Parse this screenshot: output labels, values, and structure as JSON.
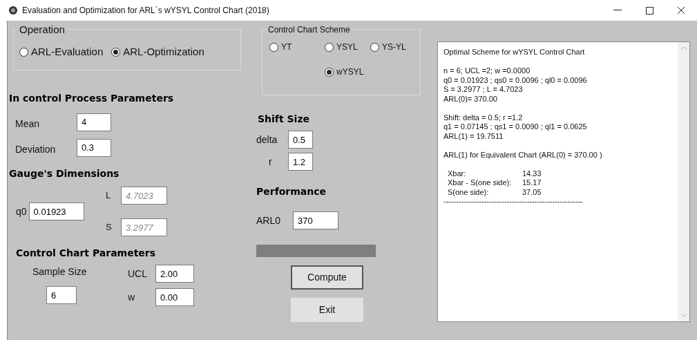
{
  "window": {
    "title": "Evaluation and Optimization for ARL´s wYSYL Control Chart (2018)"
  },
  "operation": {
    "title": "Operation",
    "options": [
      {
        "label": "ARL-Evaluation",
        "selected": false
      },
      {
        "label": "ARL-Optimization",
        "selected": true
      }
    ]
  },
  "scheme": {
    "title": "Control Chart Scheme",
    "options": [
      {
        "label": "YT",
        "selected": false
      },
      {
        "label": "YSYL",
        "selected": false
      },
      {
        "label": "YS-YL",
        "selected": false
      },
      {
        "label": "wYSYL",
        "selected": true
      }
    ]
  },
  "process": {
    "title": "In control Process Parameters",
    "fields": [
      {
        "label": "Mean",
        "value": "4"
      },
      {
        "label": "Deviation",
        "value": "0.3"
      }
    ]
  },
  "shift": {
    "title": "Shift Size",
    "fields": [
      {
        "label": "delta",
        "value": "0.5"
      },
      {
        "label": "r",
        "value": "1.2"
      }
    ]
  },
  "gauge": {
    "title": "Gauge's Dimensions",
    "q0": {
      "label": "q0",
      "value": "0.01923"
    },
    "outputs": [
      {
        "label": "L",
        "value": "4.7023",
        "disabled": true
      },
      {
        "label": "S",
        "value": "3.2977",
        "disabled": true
      }
    ]
  },
  "performance": {
    "title": "Performance",
    "field": {
      "label": "ARL0",
      "value": "370"
    }
  },
  "chart_params": {
    "title": "Control Chart Parameters",
    "sample": {
      "label": "Sample Size",
      "value": "6"
    },
    "fields": [
      {
        "label": "UCL",
        "value": "2.00"
      },
      {
        "label": "w",
        "value": "0.00"
      }
    ]
  },
  "buttons": [
    {
      "label": "Compute",
      "focused": true
    },
    {
      "label": "Exit",
      "focused": false
    }
  ],
  "output": {
    "paragraphs": [
      [
        "Optimal Scheme for wYSYL Control Chart"
      ],
      [
        "n = 6; UCL =2; w =0.0000",
        "q0 = 0.01923 ; qs0 = 0.0096 ; ql0 = 0.0096",
        "S = 3.2977 ; L = 4.7023",
        "ARL(0)= 370.00"
      ],
      [
        "Shift: delta = 0.5; r =1.2",
        "q1 = 0.07145 ; qs1 = 0.0090 ; ql1 = 0.0625",
        "ARL(1) = 19.7511"
      ],
      [
        "ARL(1) for Equivalent Chart (ARL(0) = 370.00 )"
      ]
    ],
    "rows": [
      {
        "label": "Xbar:",
        "value": "14.33"
      },
      {
        "label": "Xbar - S(one side):",
        "value": "15.17"
      },
      {
        "label": "S(one side):",
        "value": "37.05"
      }
    ],
    "rule": "-------------------------------------------------------"
  }
}
